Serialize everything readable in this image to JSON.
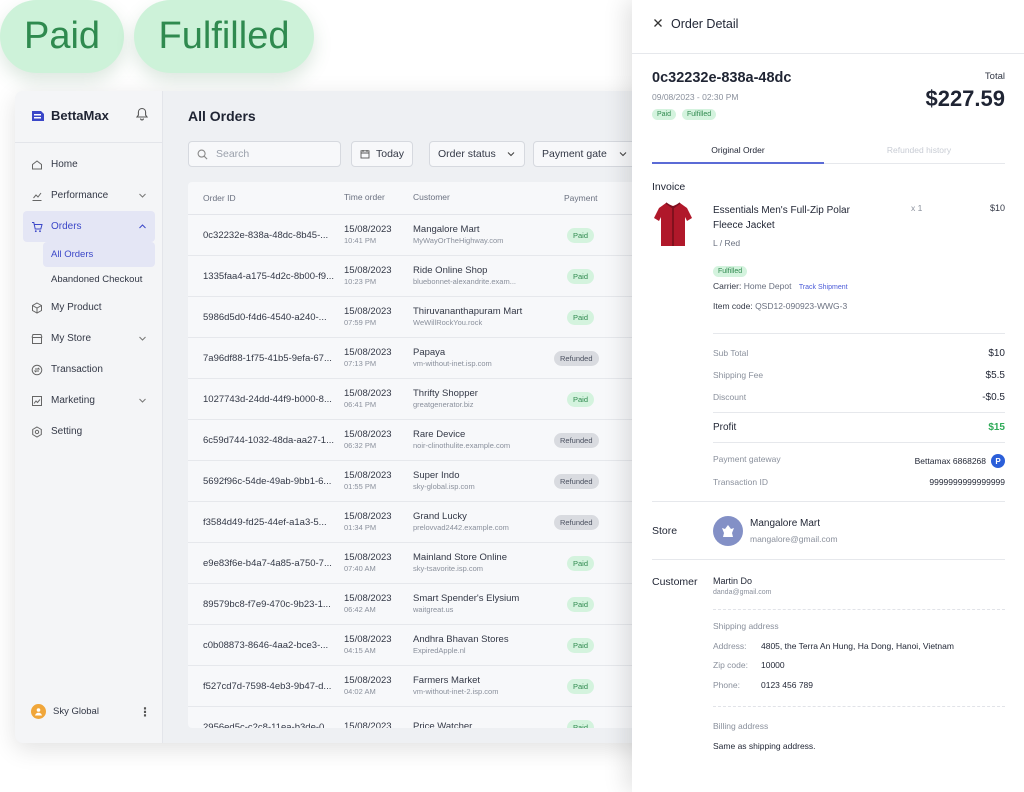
{
  "status_pills": {
    "paid": "Paid",
    "fulfilled": "Fulfilled"
  },
  "brand": {
    "name": "BettaMax"
  },
  "sidebar": {
    "items": [
      {
        "label": "Home",
        "icon": "home-icon"
      },
      {
        "label": "Performance",
        "icon": "chart-icon"
      },
      {
        "label": "Orders",
        "icon": "cart-icon"
      },
      {
        "label": "My Product",
        "icon": "box-icon"
      },
      {
        "label": "My Store",
        "icon": "store-icon"
      },
      {
        "label": "Transaction",
        "icon": "transaction-icon"
      },
      {
        "label": "Marketing",
        "icon": "marketing-icon"
      },
      {
        "label": "Setting",
        "icon": "gear-icon"
      }
    ],
    "orders_sub": [
      "All Orders",
      "Abandoned Checkout"
    ],
    "user": "Sky Global"
  },
  "main": {
    "title": "All Orders",
    "search_placeholder": "Search",
    "filters": {
      "date": "Today",
      "status": "Order status",
      "gateway": "Payment gate"
    },
    "columns": [
      "Order ID",
      "Time order",
      "Customer",
      "Payment"
    ],
    "rows": [
      {
        "id": "0c32232e-838a-48dc-8b45-...",
        "date": "15/08/2023",
        "time": "10:41 PM",
        "customer": "Mangalore Mart",
        "site": "MyWayOrTheHighway.com",
        "payment": "Paid"
      },
      {
        "id": "1335faa4-a175-4d2c-8b00-f9...",
        "date": "15/08/2023",
        "time": "10:23 PM",
        "customer": "Ride Online Shop",
        "site": "bluebonnet-alexandrite.exam...",
        "payment": "Paid"
      },
      {
        "id": "5986d5d0-f4d6-4540-a240-...",
        "date": "15/08/2023",
        "time": "07:59 PM",
        "customer": "Thiruvananthapuram Mart",
        "site": "WeWillRockYou.rock",
        "payment": "Paid"
      },
      {
        "id": "7a96df88-1f75-41b5-9efa-67...",
        "date": "15/08/2023",
        "time": "07:13 PM",
        "customer": "Papaya",
        "site": "vm-without-inet.isp.com",
        "payment": "Refunded"
      },
      {
        "id": "1027743d-24dd-44f9-b000-8...",
        "date": "15/08/2023",
        "time": "06:41 PM",
        "customer": "Thrifty Shopper",
        "site": "greatgenerator.biz",
        "payment": "Paid"
      },
      {
        "id": "6c59d744-1032-48da-aa27-1...",
        "date": "15/08/2023",
        "time": "06:32 PM",
        "customer": "Rare Device",
        "site": "noir-clinothulite.example.com",
        "payment": "Refunded"
      },
      {
        "id": "5692f96c-54de-49ab-9bb1-6...",
        "date": "15/08/2023",
        "time": "01:55 PM",
        "customer": "Super Indo",
        "site": "sky-global.isp.com",
        "payment": "Refunded"
      },
      {
        "id": "f3584d49-fd25-44ef-a1a3-5...",
        "date": "15/08/2023",
        "time": "01:34 PM",
        "customer": "Grand Lucky",
        "site": "prelovvad2442.example.com",
        "payment": "Refunded"
      },
      {
        "id": "e9e83f6e-b4a7-4a85-a750-7...",
        "date": "15/08/2023",
        "time": "07:40 AM",
        "customer": "Mainland Store Online",
        "site": "sky-tsavorite.isp.com",
        "payment": "Paid"
      },
      {
        "id": "89579bc8-f7e9-470c-9b23-1...",
        "date": "15/08/2023",
        "time": "06:42 AM",
        "customer": "Smart Spender's Elysium",
        "site": "waitgreat.us",
        "payment": "Paid"
      },
      {
        "id": "c0b08873-8646-4aa2-bce3-...",
        "date": "15/08/2023",
        "time": "04:15 AM",
        "customer": "Andhra Bhavan Stores",
        "site": "ExpiredApple.nl",
        "payment": "Paid"
      },
      {
        "id": "f527cd7d-7598-4eb3-9b47-d...",
        "date": "15/08/2023",
        "time": "04:02 AM",
        "customer": "Farmers Market",
        "site": "vm-without-inet-2.isp.com",
        "payment": "Paid"
      },
      {
        "id": "2956ed5c-c2c8-11ea-b3de-0...",
        "date": "15/08/2023",
        "time": "",
        "customer": "Price Watcher",
        "site": "",
        "payment": "Paid"
      }
    ]
  },
  "detail": {
    "title": "Order Detail",
    "order_id": "0c32232e-838a-48dc",
    "date": "09/08/2023 - 02:30 PM",
    "total_label": "Total",
    "total": "$227.59",
    "badges": [
      "Paid",
      "Fulfilled"
    ],
    "tabs": [
      "Original Order",
      "Refunded history"
    ],
    "invoice_label": "Invoice",
    "item": {
      "name": "Essentials Men's Full-Zip Polar Fleece Jacket",
      "qty": "x 1",
      "price": "$10",
      "variant": "L / Red",
      "status": "Fulfilled",
      "carrier_label": "Carrier:",
      "carrier": "Home Depot",
      "track": "Track Shipment",
      "code_label": "Item code:",
      "code": "QSD12-090923-WWG-3"
    },
    "summary": {
      "subtotal_label": "Sub Total",
      "subtotal": "$10",
      "shipping_label": "Shipping Fee",
      "shipping": "$5.5",
      "discount_label": "Discount",
      "discount": "-$0.5",
      "profit_label": "Profit",
      "profit": "$15",
      "gateway_label": "Payment gateway",
      "gateway": "Bettamax 6868268",
      "txn_label": "Transaction ID",
      "txn": "9999999999999999"
    },
    "store": {
      "label": "Store",
      "name": "Mangalore Mart",
      "email": "mangalore@gmail.com"
    },
    "customer": {
      "label": "Customer",
      "name": "Martin Do",
      "email": "danda@gmail.com",
      "shipping_heading": "Shipping address",
      "address_label": "Address:",
      "address": "4805, the Terra An Hung, Ha Dong, Hanoi, Vietnam",
      "zip_label": "Zip code:",
      "zip": "10000",
      "phone_label": "Phone:",
      "phone": "0123 456 789",
      "billing_heading": "Billing address",
      "billing": "Same as shipping address."
    }
  },
  "colors": {
    "accent": "#3b47c8",
    "paid": "#2f8a4f",
    "profit": "#2faa58"
  }
}
